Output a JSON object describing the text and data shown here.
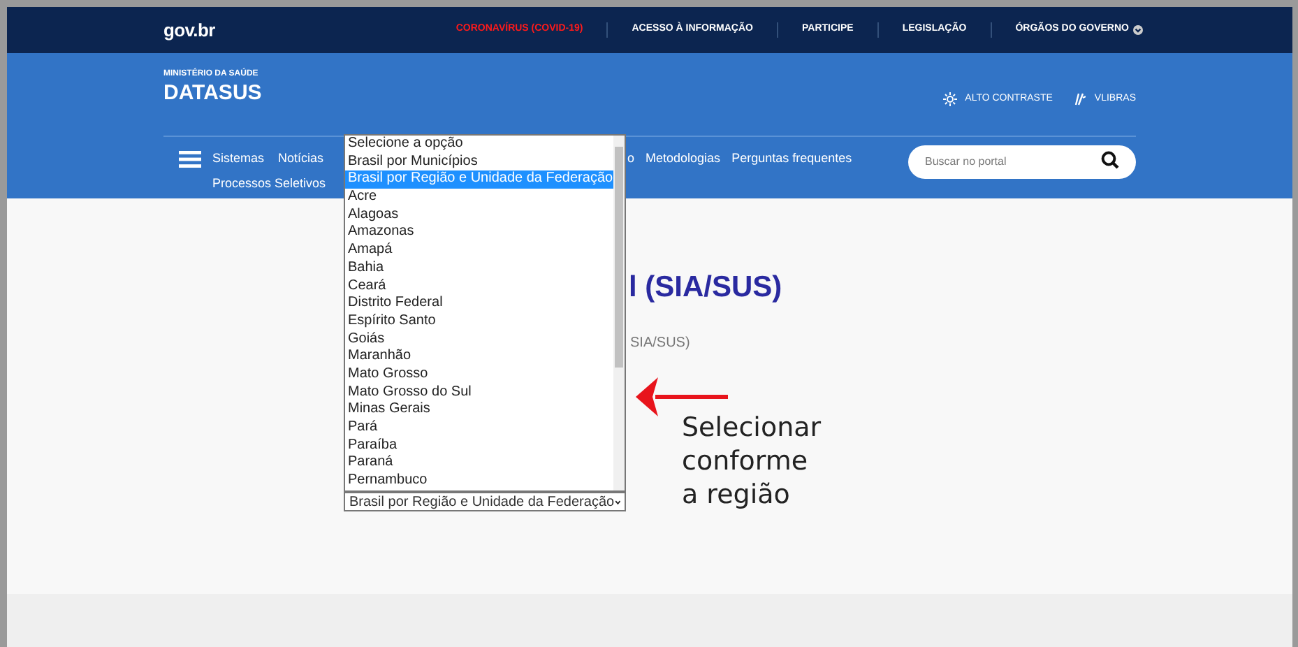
{
  "top_bar": {
    "logo": "gov.br",
    "links": [
      {
        "label": "CORONAVÍRUS (COVID-19)",
        "kind": "alert",
        "has_menu": false
      },
      {
        "label": "ACESSO À INFORMAÇÃO",
        "kind": "normal",
        "has_menu": false
      },
      {
        "label": "PARTICIPE",
        "kind": "normal",
        "has_menu": false
      },
      {
        "label": "LEGISLAÇÃO",
        "kind": "normal",
        "has_menu": false
      },
      {
        "label": "ÓRGÃOS DO GOVERNO",
        "kind": "normal",
        "has_menu": true
      }
    ]
  },
  "header": {
    "ministry": "MINISTÉRIO DA SAÚDE",
    "site_name": "DATASUS",
    "tools": [
      "ALTO CONTRASTE",
      "VLIBRAS"
    ]
  },
  "nav": {
    "row_1": [
      "Sistemas",
      "Notícias"
    ],
    "fragment": "o",
    "row_1_right": [
      "Metodologias",
      "Perguntas frequentes"
    ],
    "row_2": [
      "Processos Seletivos"
    ],
    "search": {
      "placeholder": "Buscar no portal"
    }
  },
  "content": {
    "title": "l (SIA/SUS)",
    "subtitle": "SIA/SUS)"
  },
  "select": {
    "value": "Brasil por Região e Unidade da Federação",
    "options": [
      {
        "label": "Selecione a opção",
        "selected": false
      },
      {
        "label": "Brasil por Municípios",
        "selected": false
      },
      {
        "label": "Brasil por Região e Unidade da Federação",
        "selected": true
      },
      {
        "label": "Acre",
        "selected": false
      },
      {
        "label": "Alagoas",
        "selected": false
      },
      {
        "label": "Amazonas",
        "selected": false
      },
      {
        "label": "Amapá",
        "selected": false
      },
      {
        "label": "Bahia",
        "selected": false
      },
      {
        "label": "Ceará",
        "selected": false
      },
      {
        "label": "Distrito Federal",
        "selected": false
      },
      {
        "label": "Espírito Santo",
        "selected": false
      },
      {
        "label": "Goiás",
        "selected": false
      },
      {
        "label": "Maranhão",
        "selected": false
      },
      {
        "label": "Mato Grosso",
        "selected": false
      },
      {
        "label": "Mato Grosso do Sul",
        "selected": false
      },
      {
        "label": "Minas Gerais",
        "selected": false
      },
      {
        "label": "Pará",
        "selected": false
      },
      {
        "label": "Paraíba",
        "selected": false
      },
      {
        "label": "Paraná",
        "selected": false
      },
      {
        "label": "Pernambuco",
        "selected": false
      }
    ]
  },
  "annotation": {
    "lines": [
      "Selecionar",
      "conforme",
      "a região"
    ]
  }
}
